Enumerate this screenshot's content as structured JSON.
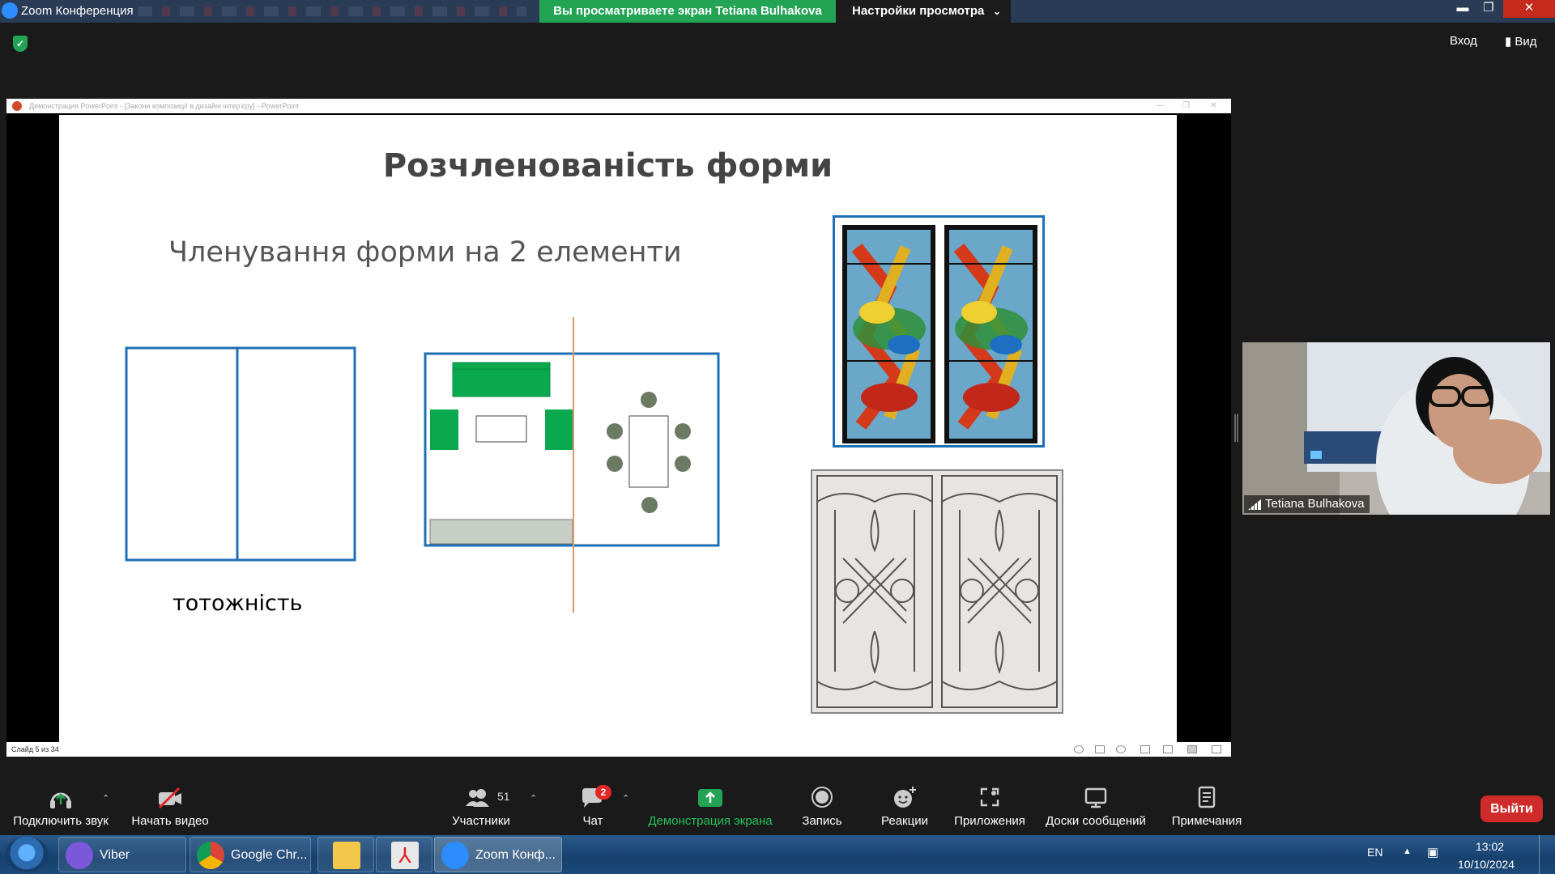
{
  "window": {
    "title": "Zoom Конференция",
    "viewing_banner": "Вы просматриваете экран Tetiana Bulhakova",
    "view_options": "Настройки просмотра"
  },
  "topbar": {
    "signin": "Вход",
    "view": "Вид"
  },
  "ppt": {
    "window_title": "Демонстрация PowerPoint - [Закони композиції в дизайні інтер'єру] - PowerPoint",
    "status_left": "Слайд 5 из 34"
  },
  "slide": {
    "title": "Розчленованість форми",
    "subtitle": "Членування форми на 2 елементи",
    "caption": "тотожність"
  },
  "participant": {
    "name": "Tetiana Bulhakova"
  },
  "toolbar": {
    "audio": "Подключить звук",
    "video": "Начать видео",
    "participants": "Участники",
    "participants_count": "51",
    "chat": "Чат",
    "chat_badge": "2",
    "share": "Демонстрация экрана",
    "record": "Запись",
    "reactions": "Реакции",
    "apps": "Приложения",
    "whiteboards": "Доски сообщений",
    "notes": "Примечания",
    "leave": "Выйти"
  },
  "taskbar": {
    "viber": "Viber",
    "chrome": "Google Chr...",
    "zoom": "Zoom Конф...",
    "lang": "EN",
    "time": "13:02",
    "date": "10/10/2024"
  },
  "colors": {
    "share_green": "#23a455",
    "leave_red": "#cf2b2b",
    "slide_blue": "#1f6fb5",
    "furniture_green": "#0aa84f"
  }
}
